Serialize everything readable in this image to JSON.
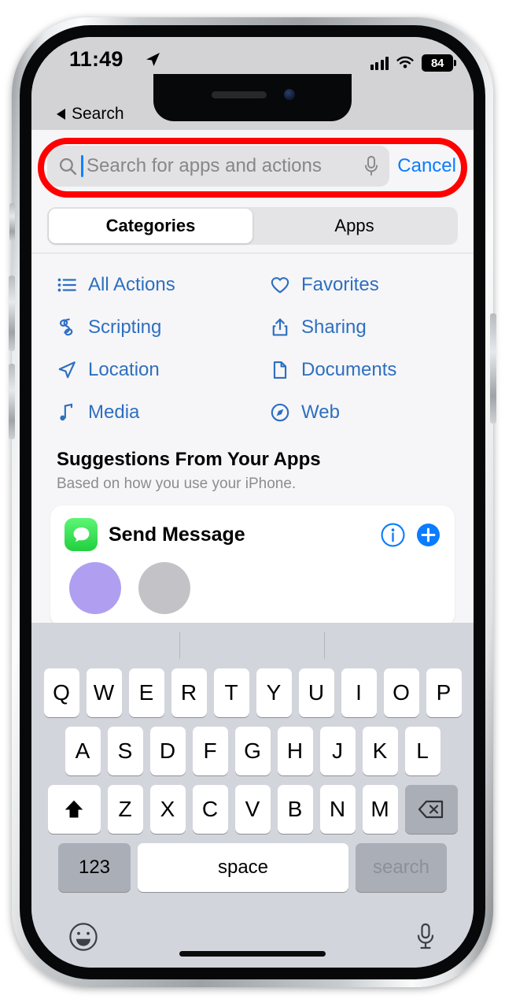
{
  "device": {
    "name": "iphone-mockup",
    "frame_color": "#9ea2a6"
  },
  "status_bar": {
    "time": "11:49",
    "location_icon": "location-arrow-icon",
    "signal_icon": "cellular-signal-icon",
    "wifi_icon": "wifi-icon",
    "battery_level": "84",
    "battery_icon": "battery-icon"
  },
  "back": {
    "icon": "back-triangle-icon",
    "label": "Search"
  },
  "search": {
    "icon": "search-icon",
    "placeholder": "Search for apps and actions",
    "value": "",
    "mic_icon": "microphone-icon",
    "cancel_label": "Cancel",
    "caret_color": "#0a84ff",
    "highlight_color": "#fe0000"
  },
  "segmented": {
    "selected": "Categories",
    "options": [
      {
        "label": "Categories",
        "selected": true
      },
      {
        "label": "Apps",
        "selected": false
      }
    ]
  },
  "categories": [
    {
      "label": "All Actions",
      "icon": "list-bullet-icon"
    },
    {
      "label": "Favorites",
      "icon": "heart-icon"
    },
    {
      "label": "Scripting",
      "icon": "scripting-icon"
    },
    {
      "label": "Sharing",
      "icon": "share-arrow-icon"
    },
    {
      "label": "Location",
      "icon": "location-arrow-icon"
    },
    {
      "label": "Documents",
      "icon": "document-page-icon"
    },
    {
      "label": "Media",
      "icon": "music-note-icon"
    },
    {
      "label": "Web",
      "icon": "safari-compass-icon"
    }
  ],
  "suggestions": {
    "title": "Suggestions From Your Apps",
    "subtitle": "Based on how you use your iPhone.",
    "cards": [
      {
        "app_icon": "messages-app-icon",
        "title": "Send Message",
        "info_icon": "info-circle-icon",
        "add_icon": "plus-circle-icon",
        "avatars": [
          "#b09ff0",
          "#c3c3c7"
        ]
      }
    ]
  },
  "keyboard": {
    "predictive_bar": {
      "suggestions": [
        "",
        "",
        ""
      ]
    },
    "row1": [
      "Q",
      "W",
      "E",
      "R",
      "T",
      "Y",
      "U",
      "I",
      "O",
      "P"
    ],
    "row2": [
      "A",
      "S",
      "D",
      "F",
      "G",
      "H",
      "J",
      "K",
      "L"
    ],
    "row3": [
      "Z",
      "X",
      "C",
      "V",
      "B",
      "N",
      "M"
    ],
    "shift_icon": "shift-up-arrow-icon",
    "delete_icon": "delete-backspace-icon",
    "numbers_label": "123",
    "space_label": "space",
    "return_label": "search",
    "return_enabled": false,
    "emoji_icon": "emoji-smiley-icon",
    "dictation_icon": "microphone-icon"
  },
  "colors": {
    "link_blue": "#2e6fc0",
    "action_blue": "#0a7cff",
    "keyboard_bg": "#d2d5db",
    "content_bg": "#f6f6f8",
    "messages_green": "#21cf3e"
  }
}
